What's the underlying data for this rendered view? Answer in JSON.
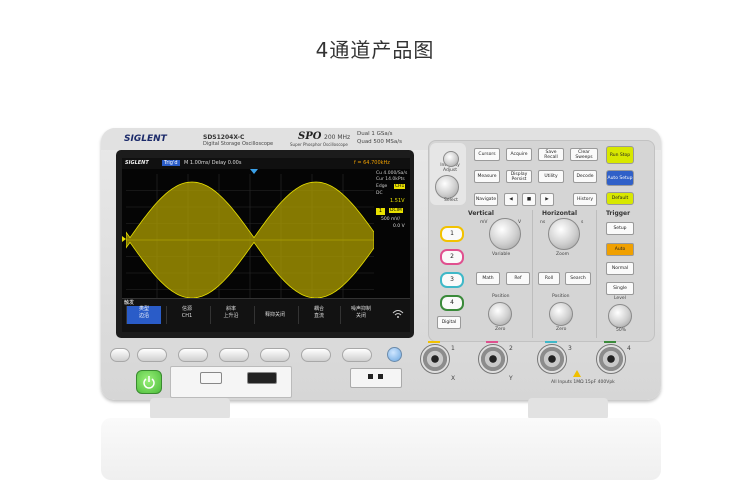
{
  "page": {
    "title": "4通道产品图"
  },
  "device": {
    "brand": "SIGLENT",
    "model": "SDS1204X-C",
    "model_sub": "Digital Storage Oscilloscope",
    "spo_logo": "SPO",
    "spo_sub": "Super Phosphor Oscilloscope",
    "bandwidth": "200 MHz",
    "spec_line1": "Dual  1 GSa/s",
    "spec_line2": "Quad  500 MSa/s"
  },
  "screen": {
    "logo": "SIGLENT",
    "run_state": "Trig'd",
    "timebase": "M 1.00ms/ Delay 0.00s",
    "freq": "f = 64.700kHz",
    "cursor_a": "Cu  4.000/Sa/s",
    "cursor_b": "Cur 14.0kPts",
    "edge_label": "Edge",
    "edge_ch": "CH1",
    "dc_label": "DC",
    "level_value": "1.51V",
    "ch_num": "1",
    "ch_coupling": "DCIM",
    "ch_scale": "500 mV/",
    "ch_offset": "0.0 V",
    "menu_title": "触发",
    "menu_items": [
      {
        "line1": "类型",
        "line2": "边沿"
      },
      {
        "line1": "信源",
        "line2": "CH1"
      },
      {
        "line1": "斜率",
        "line2": "上升沿"
      },
      {
        "line1": "释抑关闭",
        "line2": ""
      },
      {
        "line1": "耦合",
        "line2": "直流"
      },
      {
        "line1": "噪声抑制",
        "line2": "关闭"
      }
    ],
    "wifi_icon": "wifi-icon",
    "trace_color": "#e8e000",
    "accent_color": "#f0a000"
  },
  "panel": {
    "intensity_label": "Intensity Adjust",
    "select_label": "Select",
    "top_buttons": [
      "Cursors",
      "Acquire",
      "Save Recall",
      "Clear Sweeps"
    ],
    "row2_buttons": [
      "Measure",
      "Display Persist",
      "Utility"
    ],
    "navigate_label": "Navigate",
    "decode_label": "Decode",
    "history_label": "History",
    "run_stop": "Run Stop",
    "auto_setup": "Auto Setup",
    "default": "Default",
    "vertical_title": "Vertical",
    "horizontal_title": "Horizontal",
    "trigger_title": "Trigger",
    "variable_label": "Variable",
    "zoom_label": "Zoom",
    "ch_buttons": [
      "1",
      "2",
      "3",
      "4"
    ],
    "ch_colors": [
      "#f2c200",
      "#e0508f",
      "#3fb8c8",
      "#3a8a3a"
    ],
    "digital_label": "Digital",
    "math_label": "Math",
    "ref_label": "Ref",
    "roll_label": "Roll",
    "search_label": "Search",
    "position_label": "Position",
    "position_label_h": "Position",
    "zero_label": "Zero",
    "zero_label_h": "Zero",
    "setup_label": "Setup",
    "auto_label": "Auto",
    "normal_label": "Normal",
    "single_label": "Single",
    "level_label": "Level",
    "fifty_label": "50%",
    "mv_label": "mV",
    "v_label": "V",
    "ns_label": "ns",
    "s_label": "s",
    "run_color": "#d8e800",
    "auto_color": "#3060c8",
    "default_color": "#d8e800",
    "auto_trig_color": "#f0a000"
  },
  "inputs": {
    "ch_labels": [
      "1",
      "2",
      "3",
      "4"
    ],
    "axis_labels": [
      "X",
      "Y"
    ],
    "spec": "All Inputs   1MΩ 15pF   400Vpk"
  }
}
